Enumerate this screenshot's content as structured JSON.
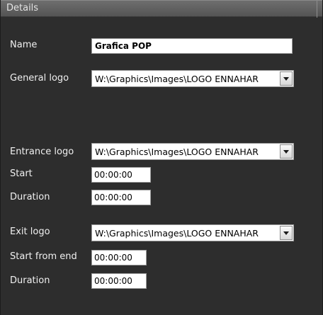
{
  "header": {
    "title": "Details"
  },
  "fields": {
    "name": {
      "label": "Name",
      "value": "Grafica POP"
    },
    "general_logo": {
      "label": "General logo",
      "value": "W:\\Graphics\\Images\\LOGO ENNAHAR"
    },
    "entrance_logo": {
      "label": "Entrance logo",
      "value": "W:\\Graphics\\Images\\LOGO ENNAHAR"
    },
    "entrance_start": {
      "label": "Start",
      "value": "00:00:00"
    },
    "entrance_duration": {
      "label": "Duration",
      "value": "00:00:00"
    },
    "exit_logo": {
      "label": "Exit logo",
      "value": "W:\\Graphics\\Images\\LOGO ENNAHAR"
    },
    "exit_start_from_end": {
      "label": "Start from end",
      "value": "00:00:00"
    },
    "exit_duration": {
      "label": "Duration",
      "value": "00:00:00"
    }
  },
  "icons": {
    "dropdown": "chevron-down-icon"
  },
  "colors": {
    "panel_bg": "#2d2d2d",
    "header_bg": "#5f5f5f",
    "label_text": "#f0f0f0"
  }
}
